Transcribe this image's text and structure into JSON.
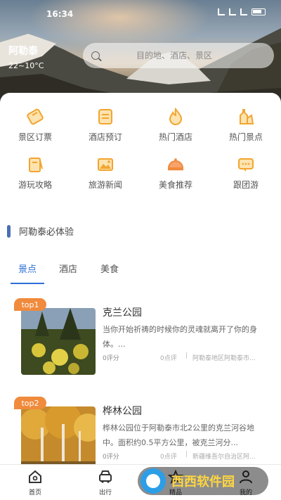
{
  "status_bar": {
    "time": "16:34"
  },
  "header": {
    "location_name": "阿勒泰",
    "temperature": "22~10°C",
    "search_placeholder": "目的地、酒店、景区"
  },
  "features": [
    {
      "label": "景区订票",
      "icon": "ticket-icon",
      "color": "#f2a530"
    },
    {
      "label": "酒店预订",
      "icon": "hotel-booking-icon",
      "color": "#f2a530"
    },
    {
      "label": "热门酒店",
      "icon": "fire-icon",
      "color": "#f2a530"
    },
    {
      "label": "热门景点",
      "icon": "landmark-icon",
      "color": "#f2a530"
    },
    {
      "label": "游玩攻略",
      "icon": "guide-book-icon",
      "color": "#f2a530"
    },
    {
      "label": "旅游新闻",
      "icon": "news-photo-icon",
      "color": "#f2a530"
    },
    {
      "label": "美食推荐",
      "icon": "food-cloche-icon",
      "color": "#f08a3c"
    },
    {
      "label": "跟团游",
      "icon": "chat-group-icon",
      "color": "#f2a530"
    }
  ],
  "section": {
    "title": "阿勒泰必体验"
  },
  "tabs": [
    {
      "label": "景点",
      "active": true
    },
    {
      "label": "酒店",
      "active": false
    },
    {
      "label": "美食",
      "active": false
    }
  ],
  "attractions": [
    {
      "badge": "top1",
      "name": "克兰公园",
      "description": "当你开始祈祷的时候你的灵魂就离开了你的身体。...",
      "score": "0评分",
      "reviews": "0点评",
      "address": "阿勒泰地区阿勒泰市..."
    },
    {
      "badge": "top2",
      "name": "桦林公园",
      "description": "桦林公园位于阿勒泰市北2公里的克兰河谷地中。面积约0.5平方公里，被克兰河分...",
      "score": "0评分",
      "reviews": "0点评",
      "address": "新疆维吾尔自治区阿..."
    }
  ],
  "bottom_nav": [
    {
      "label": "首页",
      "icon": "home-icon"
    },
    {
      "label": "出行",
      "icon": "car-icon"
    },
    {
      "label": "精品",
      "icon": "star-icon"
    },
    {
      "label": "我的",
      "icon": "user-icon"
    }
  ],
  "watermark": {
    "text": "西西软件园"
  }
}
